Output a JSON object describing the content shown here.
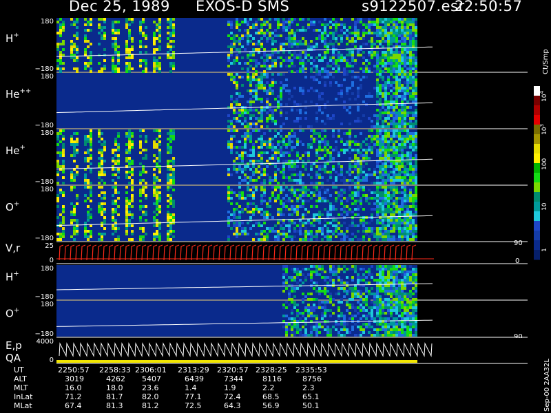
{
  "header": {
    "date": "Dec 25, 1989",
    "instrument": "EXOS-D SMS",
    "file": "s9122507.esr",
    "time": "22:50:57"
  },
  "colors": {
    "background": "#000000",
    "panel_background": "#0a2a8c",
    "trace": "#ffffff",
    "velocity_trace": "#ff2a1a",
    "qa_bar": "#f2e600"
  },
  "chart_data": {
    "type": "heatmap",
    "panels": [
      {
        "id": "h_plus",
        "label": "H",
        "sup": "+",
        "ytick_top": "180",
        "ytick_bottom": "−180",
        "kind": "spectrogram"
      },
      {
        "id": "he_pp",
        "label": "He",
        "sup": "++",
        "ytick_top": "180",
        "ytick_bottom": "−180",
        "kind": "spectrogram"
      },
      {
        "id": "he_plus",
        "label": "He",
        "sup": "+",
        "ytick_top": "180",
        "ytick_bottom": "−180",
        "kind": "spectrogram"
      },
      {
        "id": "o_plus",
        "label": "O",
        "sup": "+",
        "ytick_top": "180",
        "ytick_bottom": "−180",
        "kind": "spectrogram"
      },
      {
        "id": "vr",
        "label": "V,r",
        "sup": "",
        "ytick_top": "25",
        "ytick_bottom": "0",
        "right_top": "90",
        "right_bottom": "0",
        "kind": "velocity"
      },
      {
        "id": "h_plus_2",
        "label": "H",
        "sup": "+",
        "ytick_top": "180",
        "ytick_bottom": "−180",
        "kind": "spectrogram"
      },
      {
        "id": "o_plus_2",
        "label": "O",
        "sup": "+",
        "ytick_top": "180",
        "ytick_bottom": "−180",
        "right_top": "90",
        "right_bottom": "0",
        "kind": "spectrogram"
      },
      {
        "id": "ep_qa",
        "label": "E,p",
        "label2": "QA",
        "sup": "",
        "ytick_top": "4000",
        "ytick_bottom": "0",
        "kind": "energy"
      }
    ],
    "colorbar": {
      "unit": "Ct/Smp",
      "scale": "log",
      "range": [
        1,
        10000
      ],
      "ticks": [
        "10",
        "10",
        "100",
        "10",
        "1"
      ],
      "tick_sups": [
        "4",
        "3",
        "",
        "",
        ""
      ],
      "colors": [
        "#ffffff",
        "#7a0000",
        "#b00000",
        "#e60000",
        "#7a6e00",
        "#a59600",
        "#e6dc00",
        "#fff000",
        "#00b400",
        "#14dc14",
        "#7ad800",
        "#008c70",
        "#009a9a",
        "#1ec8dc",
        "#1e46c8",
        "#143ca8",
        "#0a2a8c",
        "#061f6a"
      ]
    },
    "orbit_table": {
      "rows": [
        {
          "label": "UT",
          "values": [
            "2250:57",
            "2258:33",
            "2306:01",
            "2313:29",
            "2320:57",
            "2328:25",
            "2335:53"
          ]
        },
        {
          "label": "ALT",
          "values": [
            "3019",
            "4262",
            "5407",
            "6439",
            "7344",
            "8116",
            "8756"
          ]
        },
        {
          "label": "MLT",
          "values": [
            "16.0",
            "18.0",
            "23.6",
            "1.4",
            "1.9",
            "2.2",
            "2.3"
          ]
        },
        {
          "label": "InLat",
          "values": [
            "71.2",
            "81.7",
            "82.0",
            "77.1",
            "72.4",
            "68.5",
            "65.1"
          ]
        },
        {
          "label": "MLat",
          "values": [
            "67.4",
            "81.3",
            "81.2",
            "72.5",
            "64.3",
            "56.9",
            "50.1"
          ]
        }
      ]
    },
    "footer": "Sep-00 2AA32L"
  }
}
